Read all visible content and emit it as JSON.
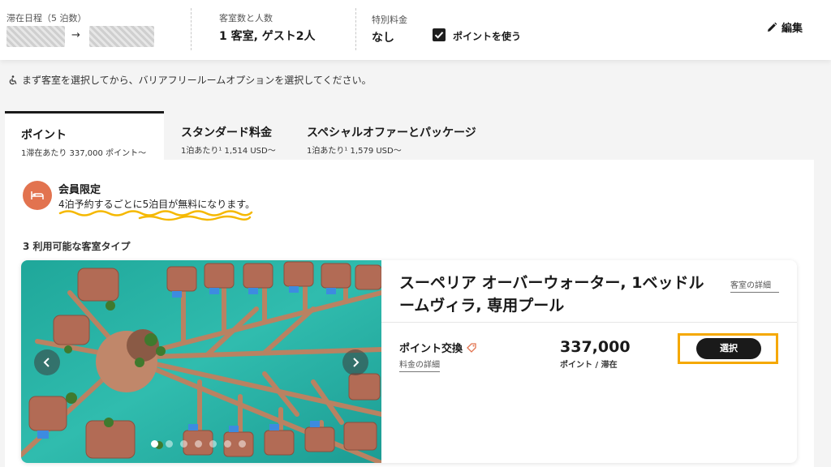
{
  "header": {
    "dates_label": "滞在日程（5 泊数）",
    "dates_arrow": "→",
    "rooms_label": "客室数と人数",
    "rooms_value": "1 客室, ゲスト2人",
    "special_rate_label": "特別料金",
    "special_rate_value": "なし",
    "use_points_label": "ポイントを使う",
    "use_points_checked": true,
    "edit_label": "編集"
  },
  "notice": {
    "icon": "wheelchair-icon",
    "text": "まず客室を選択してから、バリアフリールームオプションを選択してください。"
  },
  "tabs": [
    {
      "title": "ポイント",
      "subtitle": "1滞在あたり 337,000 ポイント〜",
      "active": true
    },
    {
      "title": "スタンダード料金",
      "subtitle": "1泊あたり¹ 1,514 USD〜",
      "active": false
    },
    {
      "title": "スペシャルオファーとパッケージ",
      "subtitle": "1泊あたり¹ 1,579 USD〜",
      "active": false
    }
  ],
  "promo": {
    "icon": "bed-icon",
    "title": "会員限定",
    "description": "4泊予約するごとに5泊目が無料になります。"
  },
  "rooms_count_text": "3 利用可能な客室タイプ",
  "room": {
    "name": "スーペリア オーバーウォーター, 1ベッドルームヴィラ, 専用プール",
    "details_link": "客室の詳細",
    "rate_title": "ポイント交換",
    "rate_details_link": "料金の詳細",
    "price": "337,000",
    "price_unit": "ポイント / 滞在",
    "select_label": "選択",
    "photo_count": 7,
    "active_photo": 1
  },
  "colors": {
    "promo_icon_bg": "#e2734f",
    "highlight": "#f5a800",
    "squiggle": "#f5b800",
    "lagoon": "#2bb3a3"
  }
}
